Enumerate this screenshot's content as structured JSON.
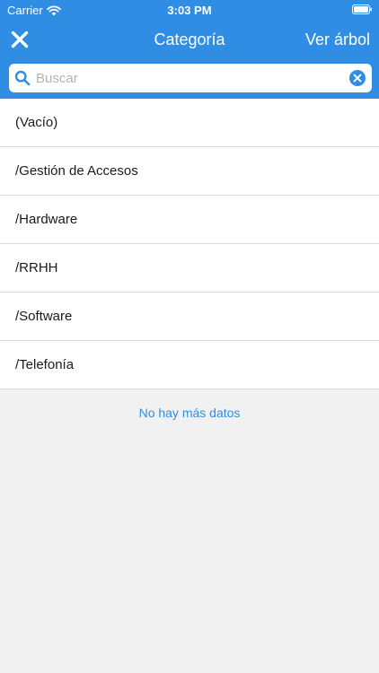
{
  "status_bar": {
    "carrier": "Carrier",
    "time": "3:03 PM",
    "icons": [
      "wifi-icon",
      "battery-icon"
    ]
  },
  "navbar": {
    "close_icon": "close-icon",
    "title": "Categoría",
    "tree_button_label": "Ver árbol"
  },
  "search": {
    "placeholder": "Buscar",
    "value": "",
    "icon": "search-icon",
    "clear_icon": "clear-icon"
  },
  "categories": [
    {
      "label": "(Vacío)"
    },
    {
      "label": "/Gestión de Accesos"
    },
    {
      "label": "/Hardware"
    },
    {
      "label": "/RRHH"
    },
    {
      "label": "/Software"
    },
    {
      "label": "/Telefonía"
    }
  ],
  "footer": {
    "no_more_data": "No hay más datos"
  },
  "colors": {
    "accent": "#2f8ee3",
    "background": "#f1f1f1",
    "list_background": "#ffffff",
    "divider": "#d9d9d9"
  }
}
